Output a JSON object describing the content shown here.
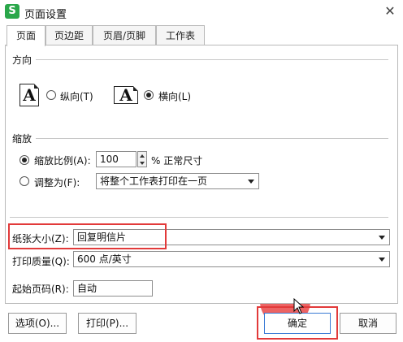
{
  "window": {
    "title": "页面设置",
    "app_icon_letter": "S"
  },
  "tabs": [
    {
      "label": "页面",
      "active": true
    },
    {
      "label": "页边距",
      "active": false
    },
    {
      "label": "页眉/页脚",
      "active": false
    },
    {
      "label": "工作表",
      "active": false
    }
  ],
  "orientation": {
    "section_label": "方向",
    "portrait_label": "纵向(T)",
    "landscape_label": "横向(L)",
    "icon_letter": "A",
    "selected": "landscape"
  },
  "scaling": {
    "section_label": "缩放",
    "scale_label": "缩放比例(A):",
    "scale_value": "100",
    "scale_unit": "% 正常尺寸",
    "fit_label": "调整为(F):",
    "fit_value": "将整个工作表打印在一页",
    "selected": "scale"
  },
  "paper": {
    "size_label": "纸张大小(Z):",
    "size_value": "回复明信片",
    "quality_label": "打印质量(Q):",
    "quality_value": "600 点/英寸",
    "first_page_label": "起始页码(R):",
    "first_page_value": "自动"
  },
  "buttons": {
    "options": "选项(O)...",
    "print": "打印(P)...",
    "ok": "确定",
    "cancel": "取消"
  },
  "colors": {
    "highlight": "#e23a3a",
    "app_green": "#2aa74a"
  }
}
